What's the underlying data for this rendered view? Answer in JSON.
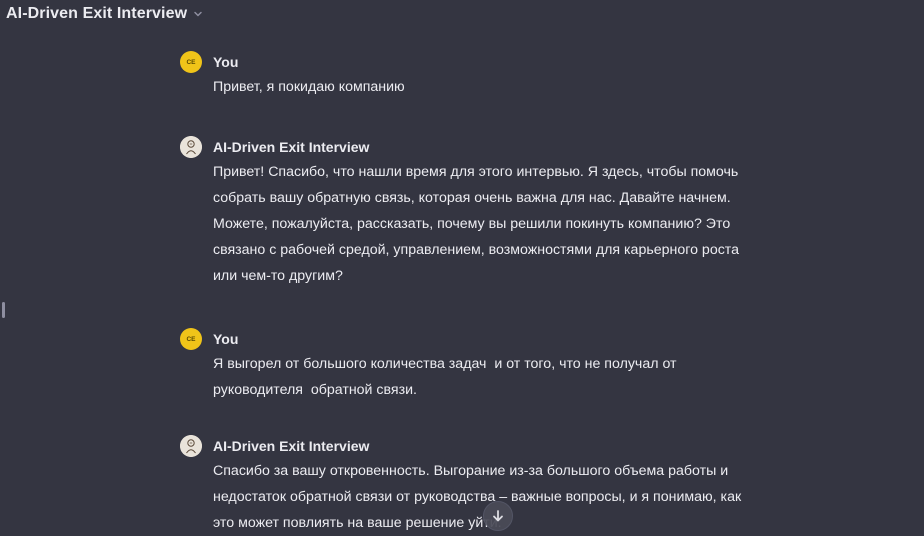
{
  "header": {
    "title": "AI-Driven Exit Interview",
    "dropdown_icon": "chevron-down-icon"
  },
  "messages": [
    {
      "role": "user",
      "author": "You",
      "avatar_initials": "CE",
      "text": "Привет, я покидаю компанию"
    },
    {
      "role": "assistant",
      "author": "AI-Driven Exit Interview",
      "avatar_icon": "bot-avatar-icon",
      "text": "Привет! Спасибо, что нашли время для этого интервью. Я здесь, чтобы помочь\nсобрать вашу обратную связь, которая очень важна для нас. Давайте начнем.\nМожете, пожалуйста, рассказать, почему вы решили покинуть компанию? Это\nсвязано с рабочей средой, управлением, возможностями для карьерного роста\nили чем-то другим?"
    },
    {
      "role": "user",
      "author": "You",
      "avatar_initials": "CE",
      "text": "Я выгорел от большого количества задач  и от того, что не получал от\nруководителя  обратной связи."
    },
    {
      "role": "assistant",
      "author": "AI-Driven Exit Interview",
      "avatar_icon": "bot-avatar-icon",
      "text": "Спасибо за вашу откровенность. Выгорание из-за большого объема работы и\nнедостаток обратной связи от руководства – важные вопросы, и я понимаю, как\nэто может повлиять на ваше решение уйти."
    }
  ],
  "scroll_button": {
    "icon": "arrow-down-icon"
  },
  "colors": {
    "background": "#343541",
    "user_avatar": "#f0c419",
    "text": "#ececf1"
  }
}
